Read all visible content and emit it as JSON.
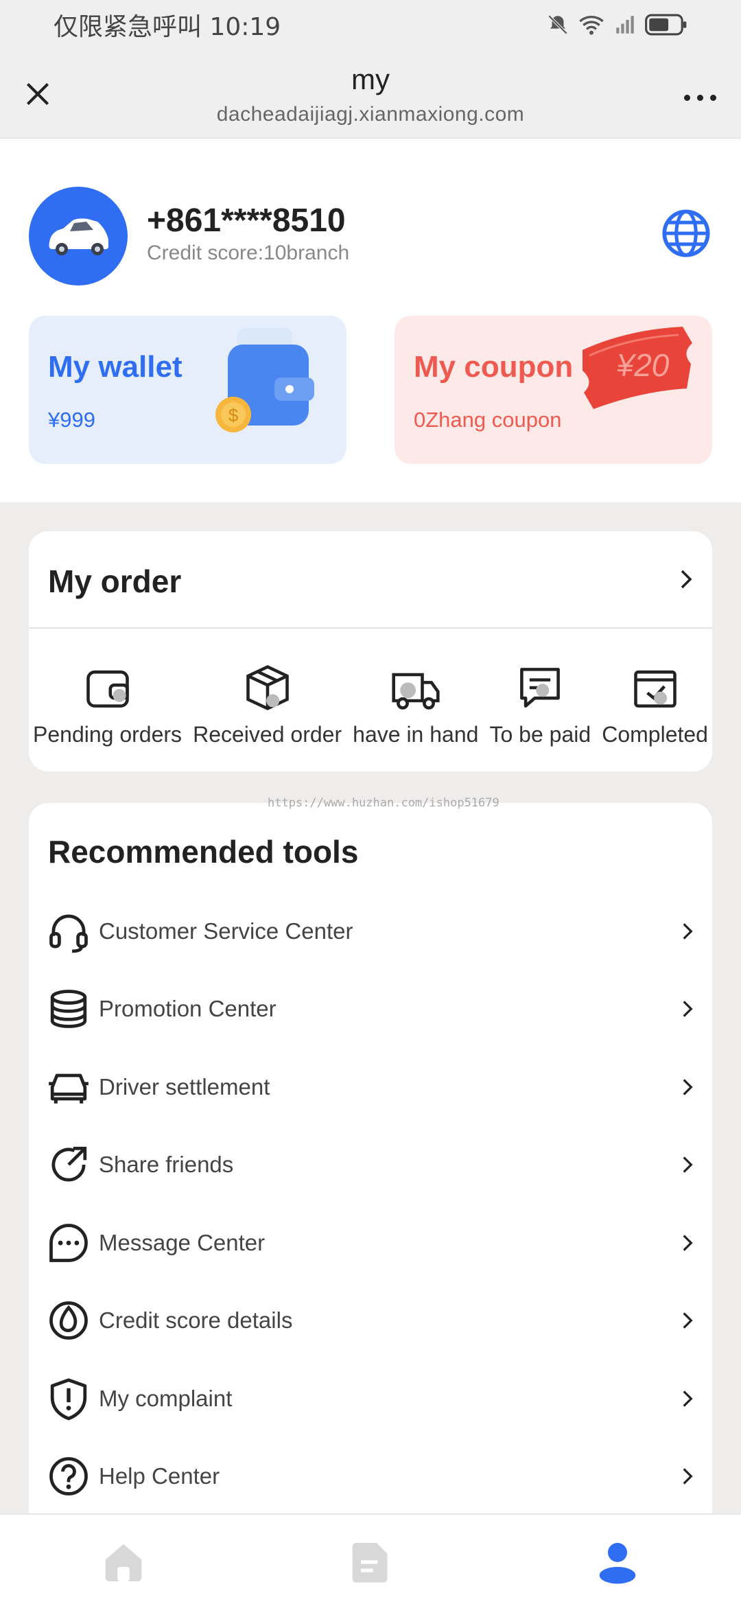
{
  "status_bar": {
    "time": "仅限紧急呼叫 10:19"
  },
  "browser": {
    "title": "my",
    "url": "dacheadaijiagj.xianmaxiong.com"
  },
  "profile": {
    "phone": "+861****8510",
    "credit_score": "Credit score:10branch"
  },
  "wallet": {
    "title": "My wallet",
    "amount": "¥999"
  },
  "coupon": {
    "title": "My coupon",
    "count": "0Zhang coupon",
    "ticket_text": "¥20"
  },
  "order": {
    "title": "My order",
    "items": [
      {
        "label": "Pending orders",
        "icon": "wallet-card-icon"
      },
      {
        "label": "Received order",
        "icon": "box-icon"
      },
      {
        "label": "have in hand",
        "icon": "truck-icon"
      },
      {
        "label": "To be paid",
        "icon": "message-card-icon"
      },
      {
        "label": "Completed",
        "icon": "completed-calendar-icon"
      }
    ]
  },
  "watermark": "https://www.huzhan.com/ishop51679",
  "tools": {
    "title": "Recommended tools",
    "items": [
      {
        "label": "Customer Service Center",
        "icon": "headset-icon"
      },
      {
        "label": "Promotion Center",
        "icon": "coin-stack-icon"
      },
      {
        "label": "Driver settlement",
        "icon": "car-icon"
      },
      {
        "label": "Share friends",
        "icon": "share-arrow-icon"
      },
      {
        "label": "Message Center",
        "icon": "chat-bubble-icon"
      },
      {
        "label": "Credit score details",
        "icon": "drop-icon"
      },
      {
        "label": "My complaint",
        "icon": "shield-alert-icon"
      },
      {
        "label": "Help Center",
        "icon": "help-icon"
      }
    ]
  },
  "bottom_nav": [
    {
      "icon": "home-icon",
      "active": false
    },
    {
      "icon": "document-icon",
      "active": false
    },
    {
      "icon": "profile-icon",
      "active": true
    }
  ],
  "colors": {
    "accent": "#2f6ef2",
    "coupon": "#ee5a4f",
    "inactive_nav": "#d8d8d8"
  }
}
